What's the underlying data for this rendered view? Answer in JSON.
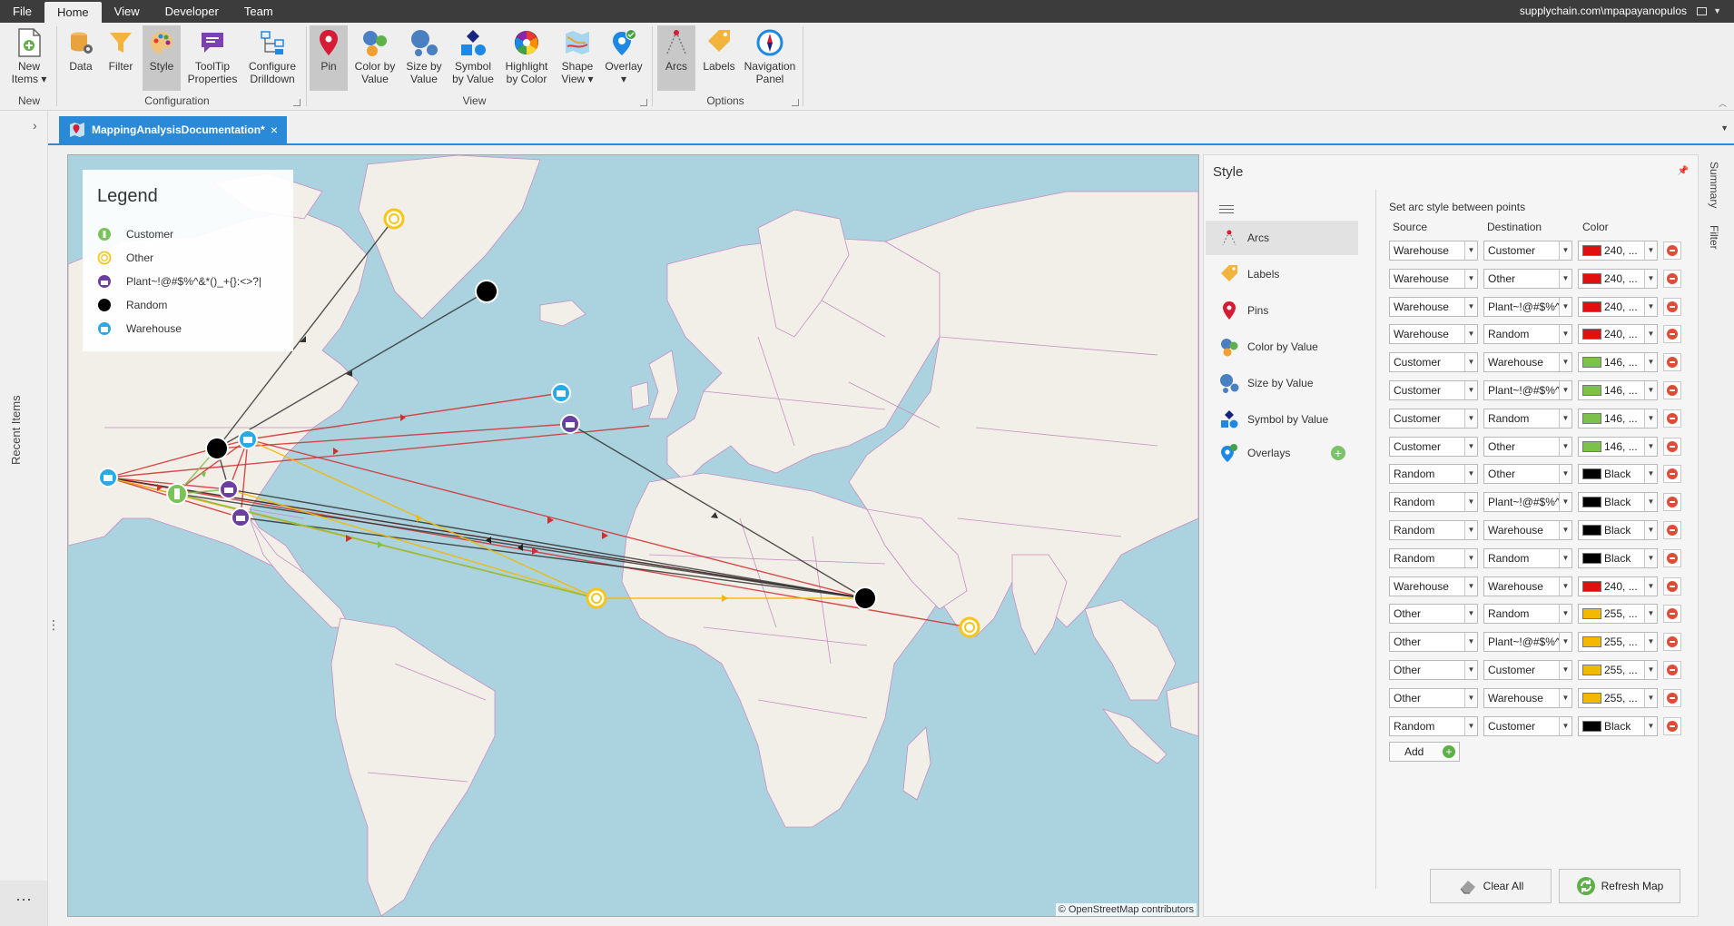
{
  "menu": {
    "tabs": [
      "File",
      "Home",
      "View",
      "Developer",
      "Team"
    ],
    "active": "Home",
    "user": "supplychain.com\\mpapayanopulos"
  },
  "ribbon": {
    "buttons": {
      "new_items": "New\nItems ▾",
      "data": "Data",
      "filter": "Filter",
      "style": "Style",
      "tooltip": "ToolTip\nProperties",
      "configure": "Configure\nDrilldown",
      "pin": "Pin",
      "color_by_value": "Color by\nValue",
      "size_by_value": "Size by\nValue",
      "symbol_by_value": "Symbol\nby Value",
      "highlight": "Highlight\nby Color",
      "shape_view": "Shape\nView ▾",
      "overlay": "Overlay\n▾",
      "arcs": "Arcs",
      "labels": "Labels",
      "navigation": "Navigation\nPanel"
    },
    "groups": {
      "new": "New",
      "configuration": "Configuration",
      "view": "View",
      "options": "Options"
    }
  },
  "leftrail": {
    "recent": "Recent Items",
    "more": "···"
  },
  "document_tab": {
    "title": "MappingAnalysisDocumentation*",
    "close": "×"
  },
  "legend": {
    "title": "Legend",
    "items": [
      {
        "label": "Customer",
        "color": "#7ac35a"
      },
      {
        "label": "Other",
        "color": "#f5c518"
      },
      {
        "label": "Plant~!@#$%^&*()_+{}:<>?|",
        "color": "#6b3fa0"
      },
      {
        "label": "Random",
        "color": "#000000"
      },
      {
        "label": "Warehouse",
        "color": "#29a9e8"
      }
    ]
  },
  "map": {
    "attribution": "© OpenStreetMap contributors",
    "water": "#aad3df",
    "land": "#f2efe9",
    "borders": "#c78ec3"
  },
  "style_panel": {
    "title": "Style",
    "nav": [
      {
        "label": "Arcs",
        "icon": "arcs-icon"
      },
      {
        "label": "Labels",
        "icon": "tag-icon"
      },
      {
        "label": "Pins",
        "icon": "pin-icon"
      },
      {
        "label": "Color by Value",
        "icon": "color-value-icon"
      },
      {
        "label": "Size by Value",
        "icon": "size-value-icon"
      },
      {
        "label": "Symbol by Value",
        "icon": "symbol-value-icon"
      },
      {
        "label": "Overlays",
        "icon": "overlay-icon"
      }
    ],
    "arcs": {
      "header": "Set arc style between points",
      "columns": {
        "source": "Source",
        "destination": "Destination",
        "color": "Color"
      },
      "rows": [
        {
          "source": "Warehouse",
          "destination": "Customer",
          "color_label": "240, ...",
          "swatch": "#e01010"
        },
        {
          "source": "Warehouse",
          "destination": "Other",
          "color_label": "240, ...",
          "swatch": "#e01010"
        },
        {
          "source": "Warehouse",
          "destination": "Plant~!@#$%^",
          "color_label": "240, ...",
          "swatch": "#e01010"
        },
        {
          "source": "Warehouse",
          "destination": "Random",
          "color_label": "240, ...",
          "swatch": "#e01010"
        },
        {
          "source": "Customer",
          "destination": "Warehouse",
          "color_label": "146, ...",
          "swatch": "#7cc24a"
        },
        {
          "source": "Customer",
          "destination": "Plant~!@#$%^",
          "color_label": "146, ...",
          "swatch": "#7cc24a"
        },
        {
          "source": "Customer",
          "destination": "Random",
          "color_label": "146, ...",
          "swatch": "#7cc24a"
        },
        {
          "source": "Customer",
          "destination": "Other",
          "color_label": "146, ...",
          "swatch": "#7cc24a"
        },
        {
          "source": "Random",
          "destination": "Other",
          "color_label": "Black",
          "swatch": "#000000"
        },
        {
          "source": "Random",
          "destination": "Plant~!@#$%^",
          "color_label": "Black",
          "swatch": "#000000"
        },
        {
          "source": "Random",
          "destination": "Warehouse",
          "color_label": "Black",
          "swatch": "#000000"
        },
        {
          "source": "Random",
          "destination": "Random",
          "color_label": "Black",
          "swatch": "#000000"
        },
        {
          "source": "Warehouse",
          "destination": "Warehouse",
          "color_label": "240, ...",
          "swatch": "#e01010"
        },
        {
          "source": "Other",
          "destination": "Random",
          "color_label": "255, ...",
          "swatch": "#f5b800"
        },
        {
          "source": "Other",
          "destination": "Plant~!@#$%^",
          "color_label": "255, ...",
          "swatch": "#f5b800"
        },
        {
          "source": "Other",
          "destination": "Customer",
          "color_label": "255, ...",
          "swatch": "#f5b800"
        },
        {
          "source": "Other",
          "destination": "Warehouse",
          "color_label": "255, ...",
          "swatch": "#f5b800"
        },
        {
          "source": "Random",
          "destination": "Customer",
          "color_label": "Black",
          "swatch": "#000000"
        }
      ],
      "add_label": "Add"
    },
    "clear_all": "Clear All",
    "refresh_map": "Refresh Map"
  },
  "rightrail": {
    "summary": "Summary",
    "filter": "Filter"
  }
}
